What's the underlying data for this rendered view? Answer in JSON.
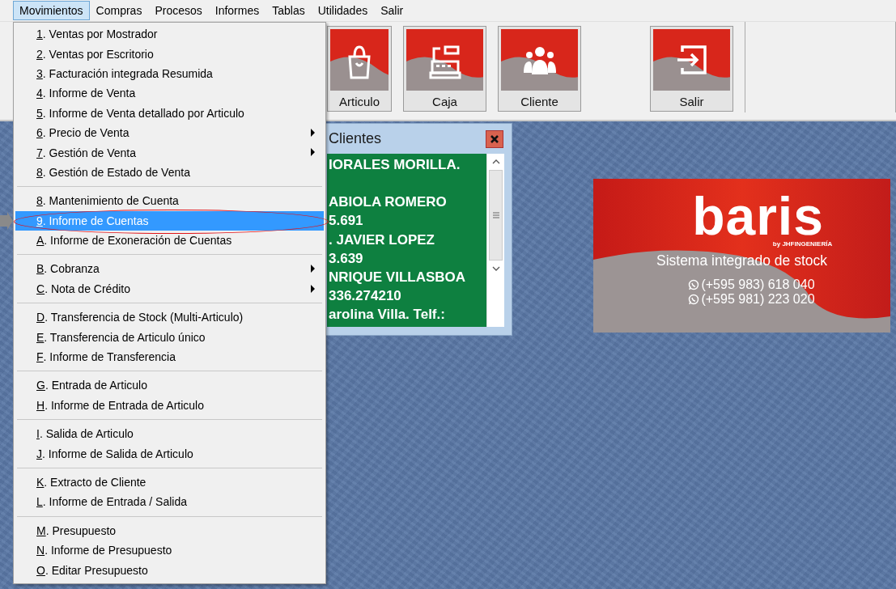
{
  "menubar": [
    {
      "label": "Movimientos",
      "selected": true
    },
    {
      "label": "Compras",
      "selected": false
    },
    {
      "label": "Procesos",
      "selected": false
    },
    {
      "label": "Informes",
      "selected": false
    },
    {
      "label": "Tablas",
      "selected": false
    },
    {
      "label": "Utilidades",
      "selected": false
    },
    {
      "label": "Salir",
      "selected": false
    }
  ],
  "toolbar": [
    {
      "label": "Articulo",
      "kind": "bag"
    },
    {
      "label": "Caja",
      "kind": "register"
    },
    {
      "label": "Cliente",
      "kind": "people"
    },
    {
      "label": "Salir",
      "kind": "exit"
    }
  ],
  "menu": {
    "groups": [
      {
        "items": [
          {
            "key": "1",
            "rest": ". Ventas por Mostrador",
            "submenu": false,
            "selected": false
          },
          {
            "key": "2",
            "rest": ". Ventas por Escritorio",
            "submenu": false,
            "selected": false
          },
          {
            "key": "3",
            "rest": ". Facturación integrada Resumida",
            "submenu": false,
            "selected": false
          },
          {
            "key": "4",
            "rest": ". Informe de Venta",
            "submenu": false,
            "selected": false
          },
          {
            "key": "5",
            "rest": ". Informe de Venta detallado por Articulo",
            "submenu": false,
            "selected": false
          },
          {
            "key": "6",
            "rest": ". Precio de Venta",
            "submenu": true,
            "selected": false
          },
          {
            "key": "7",
            "rest": ". Gestión de Venta",
            "submenu": true,
            "selected": false
          },
          {
            "key": "8",
            "rest": ". Gestión de Estado de Venta",
            "submenu": false,
            "selected": false
          }
        ]
      },
      {
        "items": [
          {
            "key": "8",
            "rest": ". Mantenimiento de Cuenta",
            "submenu": false,
            "selected": false
          },
          {
            "key": "9",
            "rest": ". Informe de Cuentas",
            "submenu": false,
            "selected": true
          },
          {
            "key": "A",
            "rest": ". Informe de Exoneración de Cuentas",
            "submenu": false,
            "selected": false
          }
        ]
      },
      {
        "items": [
          {
            "key": "B",
            "rest": ". Cobranza",
            "submenu": true,
            "selected": false
          },
          {
            "key": "C",
            "rest": ". Nota de Crédito",
            "submenu": true,
            "selected": false
          }
        ]
      },
      {
        "items": [
          {
            "key": "D",
            "rest": ". Transferencia de Stock (Multi-Articulo)",
            "submenu": false,
            "selected": false
          },
          {
            "key": "E",
            "rest": ". Transferencia de Articulo único",
            "submenu": false,
            "selected": false
          },
          {
            "key": "F",
            "rest": ". Informe de Transferencia",
            "submenu": false,
            "selected": false
          }
        ]
      },
      {
        "items": [
          {
            "key": "G",
            "rest": ". Entrada de Articulo",
            "submenu": false,
            "selected": false
          },
          {
            "key": "H",
            "rest": ". Informe de Entrada de Articulo",
            "submenu": false,
            "selected": false
          }
        ]
      },
      {
        "items": [
          {
            "key": "I",
            "rest": ". Salida de Articulo",
            "submenu": false,
            "selected": false
          },
          {
            "key": "J",
            "rest": ". Informe de Salida de Articulo",
            "submenu": false,
            "selected": false
          }
        ]
      },
      {
        "items": [
          {
            "key": "K",
            "rest": ". Extracto de Cliente",
            "submenu": false,
            "selected": false
          },
          {
            "key": "L",
            "rest": ". Informe de Entrada / Salida",
            "submenu": false,
            "selected": false
          }
        ]
      },
      {
        "items": [
          {
            "key": "M",
            "rest": ". Presupuesto",
            "submenu": false,
            "selected": false
          },
          {
            "key": "N",
            "rest": ". Informe de Presupuesto",
            "submenu": false,
            "selected": false
          },
          {
            "key": "O",
            "rest": ". Editar Presupuesto",
            "submenu": false,
            "selected": false
          }
        ]
      }
    ]
  },
  "clientes_window": {
    "title": "Clientes",
    "paragraphs": [
      [
        "IORALES MORILLA."
      ],
      [
        "ABIOLA ROMERO",
        "5.691",
        ". JAVIER LOPEZ",
        "3.639",
        "NRIQUE VILLASBOA",
        "336.274210",
        "arolina Villa. Telf.:"
      ]
    ]
  },
  "logo_card": {
    "brand": "baris",
    "byline": "by JHFINGENIERÍA",
    "tagline": "Sistema integrado de stock",
    "phones": [
      "(+595 983) 618 040",
      "(+595 981) 223 020"
    ]
  }
}
